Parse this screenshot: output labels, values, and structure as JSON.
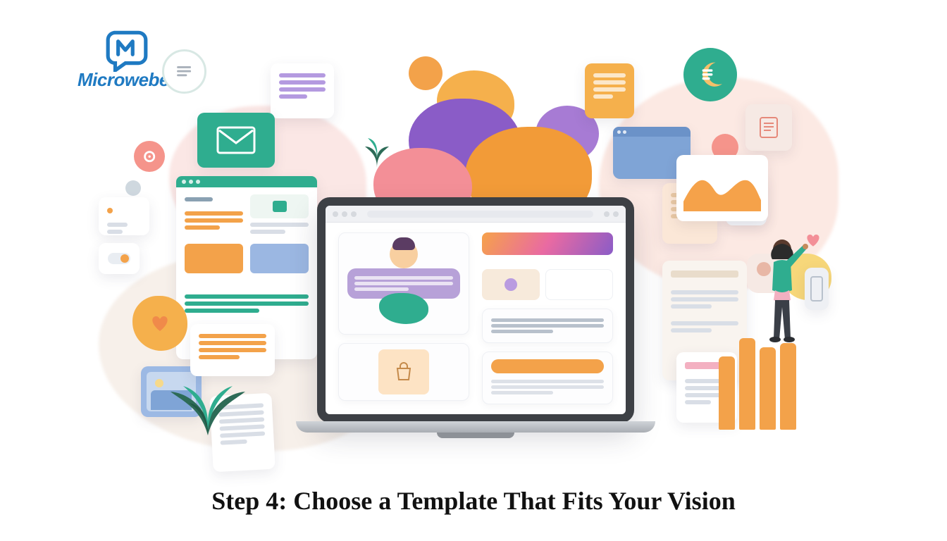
{
  "brand": {
    "name": "Microweber"
  },
  "headline": "Step 4: Choose a Template That Fits Your Vision",
  "icons": {
    "mail": "mail-icon",
    "doc": "doc-icon",
    "record": "record-icon",
    "moon": "moon-icon",
    "bookmark": "bookmark-icon",
    "heart": "heart-icon",
    "image": "image-icon",
    "bag": "bag-icon",
    "chart": "chart-icon"
  },
  "colors": {
    "brandBlue": "#1f7ac2",
    "teal": "#2fad8f",
    "orange": "#f3a24a",
    "purple": "#8a5cc7",
    "pink": "#f3b0c1",
    "coral": "#f38f97",
    "darkFrame": "#3d4045"
  }
}
